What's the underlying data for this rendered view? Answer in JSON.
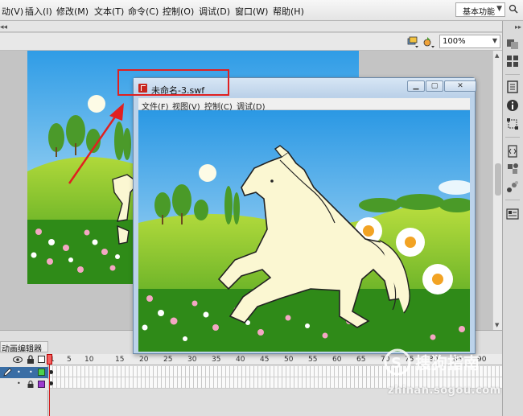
{
  "menubar": {
    "items": [
      "动(V)",
      "插入(I)",
      "修改(M)",
      "文本(T)",
      "命令(C)",
      "控制(O)",
      "调试(D)",
      "窗口(W)",
      "帮助(H)"
    ],
    "workspace": "基本功能"
  },
  "toolbar": {
    "zoom": "100%"
  },
  "swf_window": {
    "title": "未命名-3.swf",
    "menu": [
      "文件(F)",
      "视图(V)",
      "控制(C)",
      "调试(D)"
    ]
  },
  "timeline": {
    "tab_label": "动画编辑器",
    "frame_numbers": [
      "1",
      "5",
      "10",
      "15",
      "20",
      "25",
      "30",
      "35",
      "40",
      "45",
      "50",
      "55",
      "60",
      "65",
      "70",
      "75",
      "80",
      "85",
      "90"
    ]
  },
  "colors": {
    "annotation_red": "#e02020",
    "sky_blue": "#4fb3ee",
    "grass_green": "#5aaa1c",
    "horse_cream": "#fbf7d2"
  },
  "watermark": {
    "url": "zhinan.sogou.com"
  }
}
